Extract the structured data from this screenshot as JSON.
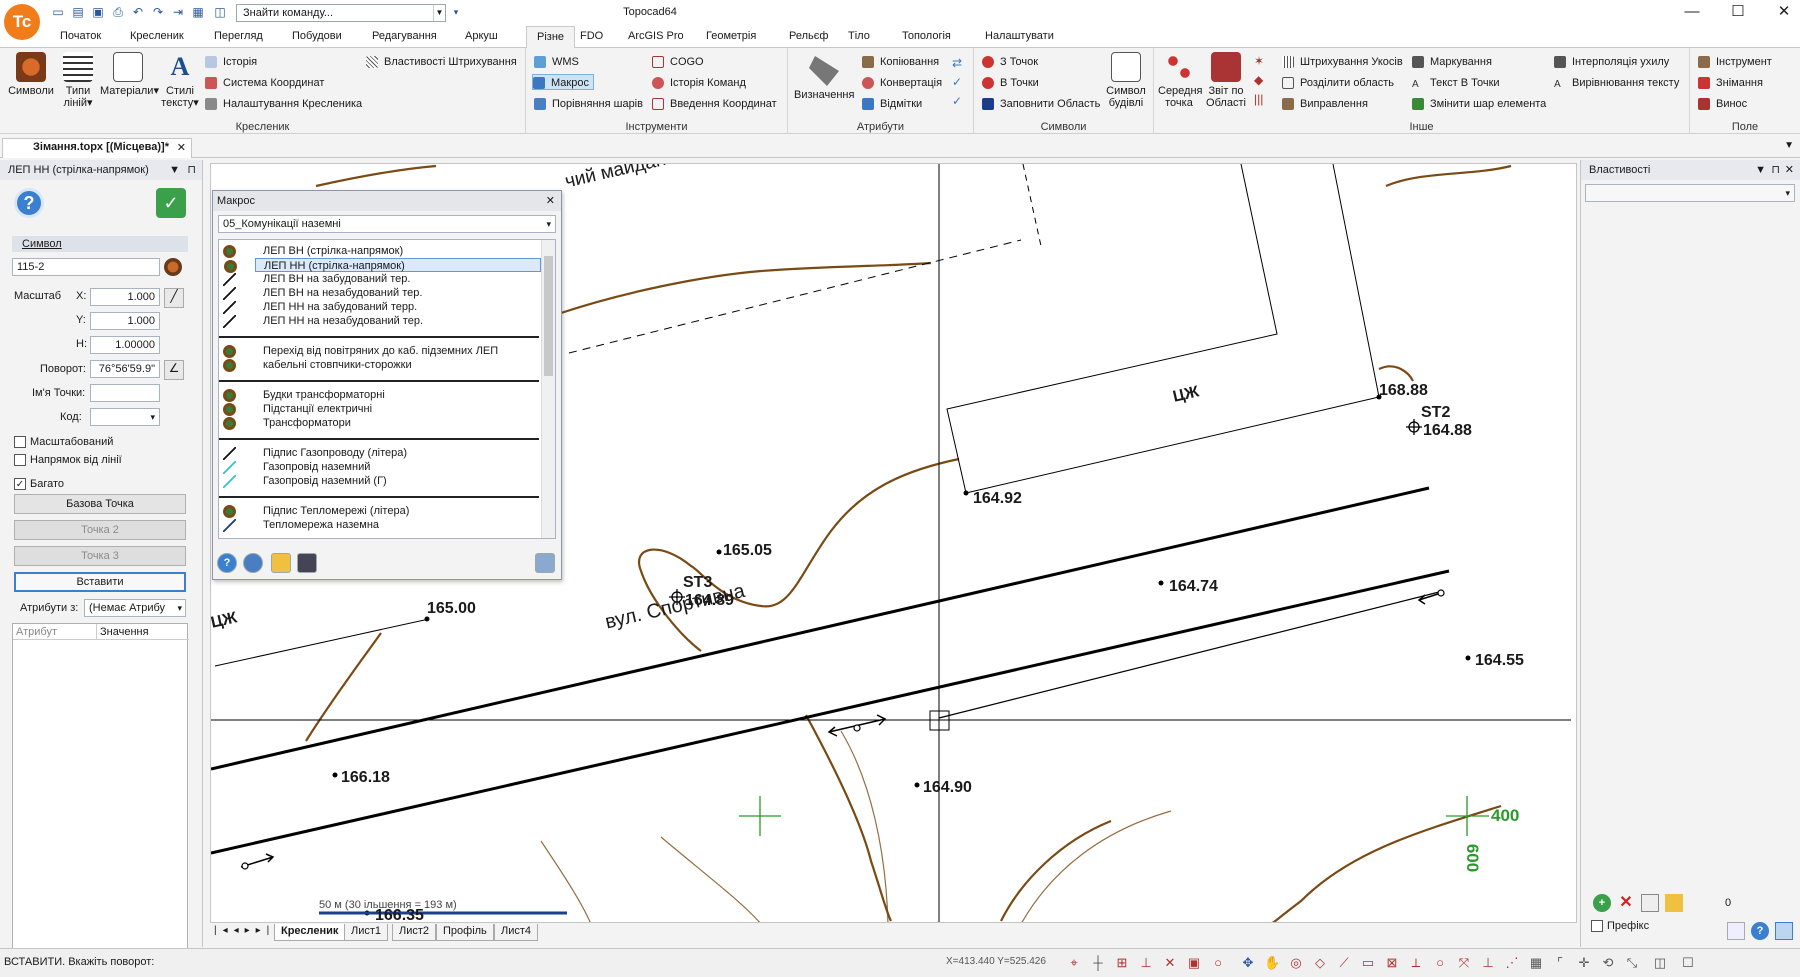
{
  "app": {
    "title": "Topocad64",
    "command_placeholder": "Знайти команду...",
    "logo": "Tc"
  },
  "menu": [
    "Початок",
    "Кресленик",
    "Перегляд",
    "Побудови",
    "Редагування",
    "Аркуш",
    "Різне",
    "FDO",
    "ArcGIS Pro",
    "Геометрія",
    "Рельєф",
    "Тіло",
    "Топологія",
    "Налаштувати"
  ],
  "ribbon": {
    "kreslenyk": {
      "label": "Кресленик",
      "symbols": "Символи",
      "line_types": "Типи ліній",
      "materials": "Матеріали",
      "text_styles": "Стилі тексту",
      "history": "Історія",
      "coord_system": "Система Координат",
      "drawing_settings": "Налаштування Кресленика",
      "hatch_props": "Властивості Штрихування"
    },
    "instrumenty": {
      "label": "Інструменти",
      "wms": "WMS",
      "macro": "Макрос",
      "compare_layers": "Порівняння шарів",
      "cogo": "COGO",
      "cmd_history": "Історія Команд",
      "coord_input": "Введення Координат"
    },
    "atrybuty": {
      "label": "Атрибути",
      "definition": "Визначення",
      "copy": "Копіювання",
      "convert": "Конвертація",
      "marks": "Відмітки"
    },
    "symvoly": {
      "label": "Символи",
      "from_points": "З Точок",
      "to_points": "В Точки",
      "fill_area": "Заповнити Область",
      "building_symbol": "Символ будівлі"
    },
    "inshe": {
      "label": "Інше",
      "middle_point": "Середня точка",
      "area_report": "Звіт по Області",
      "slope_hatch": "Штрихування Укосів",
      "split_area": "Розділити область",
      "fix": "Виправлення",
      "marking": "Маркування",
      "text_to_points": "Текст В Точки",
      "change_layer": "Змінити шар елемента",
      "angle_interp": "Інтерполяція ухилу",
      "text_align": "Вирівнювання тексту"
    },
    "pole": {
      "label": "Поле",
      "instrument": "Інструмент",
      "survey": "Знімання",
      "stakeout": "Винос"
    }
  },
  "doc_tab": "Зімання.topx [(Місцева)]*",
  "left_panel": {
    "header": "ЛЕП НН (стрілка-напрямок)",
    "symbol_label": "Символ",
    "symbol_value": "115-2",
    "scale_label": "Масштаб",
    "x_label": "X:",
    "x_value": "1.000",
    "y_label": "Y:",
    "y_value": "1.000",
    "h_label": "H:",
    "h_value": "1.00000",
    "rotation_label": "Поворот:",
    "rotation_value": "76°56'59.9\"",
    "point_name_label": "Ім'я Точки:",
    "code_label": "Код:",
    "scaled": "Масштабований",
    "direction_from_line": "Напрямок від лінії",
    "many": "Багато",
    "base_point": "Базова Точка",
    "point2": "Точка 2",
    "point3": "Точка 3",
    "insert": "Вставити",
    "attrs_from_label": "Атрибути з:",
    "attrs_from_value": "(Немає Атрибу",
    "attr_col": "Атрибут",
    "value_col": "Значення"
  },
  "macro": {
    "title": "Макрос",
    "category": "05_Комунікації наземні",
    "items": [
      "ЛЕП ВН (стрілка-напрямок)",
      "ЛЕП НН (стрілка-напрямок)",
      "ЛЕП ВН на забудований тер.",
      "ЛЕП ВН на незабудований тер.",
      "ЛЕП НН на забудований терр.",
      "ЛЕП НН на незабудований тер.",
      "Перехід від повітряних до каб. підземних ЛЕП",
      "кабельні стовпчики-сторожки",
      "Будки трансформаторні",
      "Підстанції електричні",
      "Трансформатори",
      "Підпис Газопроводу (літера)",
      "Газопровід наземний",
      "Газопровід наземний (Г)",
      "Підпис Тепломережі (літера)",
      "Тепломережа наземна"
    ]
  },
  "right_panel": {
    "title": "Властивості",
    "count": "0",
    "prefix": "Префікс"
  },
  "map": {
    "street": "вул. Спортивна",
    "maidanchyk": "чий майданчик",
    "cz1": "ЦЖ",
    "cz2": "ЦЖ",
    "elev": [
      "165.05",
      "164.89",
      "165.00",
      "164.92",
      "168.88",
      "164.88",
      "164.74",
      "164.55",
      "166.18",
      "164.90",
      "166.35"
    ],
    "st2": "ST2",
    "st3": "ST3",
    "g400": "400",
    "g600": "600",
    "scale_text": "50 м (30 ільшення = 193 м)"
  },
  "sheet_tabs": [
    "Кресленик",
    "Лист1",
    "Лист2",
    "Профіль",
    "Лист4"
  ],
  "status": {
    "text": "ВСТАВИТИ. Вкажіть поворот:",
    "coords": "X=413.440 Y=525.426"
  }
}
